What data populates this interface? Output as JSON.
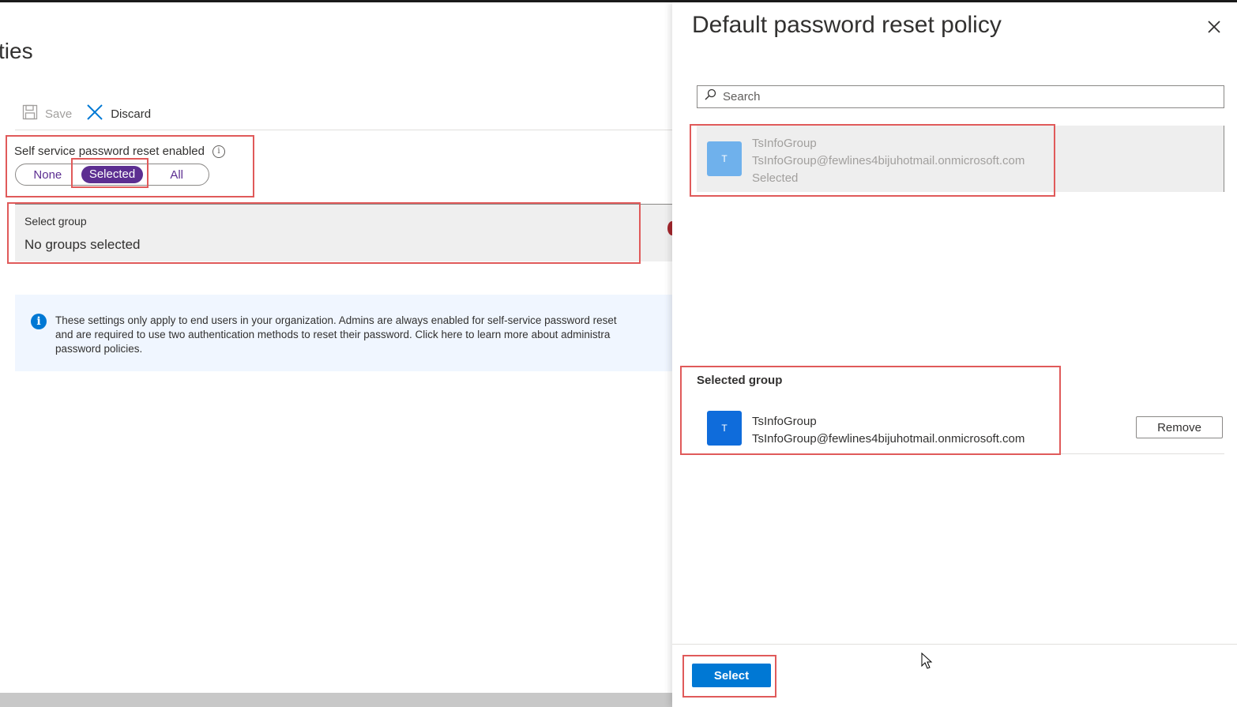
{
  "left": {
    "title": "ties",
    "toolbar": {
      "save_label": "Save",
      "discard_label": "Discard"
    },
    "sspr": {
      "label": "Self service password reset enabled",
      "info_icon": "info-icon",
      "options": [
        "None",
        "Selected",
        "All"
      ],
      "selected_option": "Selected"
    },
    "select_group": {
      "label": "Select group",
      "value": "No groups selected"
    },
    "info_banner": {
      "lines": [
        "These settings only apply to end users in your organization. Admins are always enabled for self-service password reset",
        "and are required to use two authentication methods to reset their password. Click here to learn more about administra",
        "password policies."
      ]
    }
  },
  "panel": {
    "title": "Default password reset policy",
    "search": {
      "placeholder": "Search",
      "value": ""
    },
    "result": {
      "avatar_letter": "T",
      "name": "TsInfoGroup",
      "email": "TsInfoGroup@fewlines4bijuhotmail.onmicrosoft.com",
      "status": "Selected"
    },
    "selected_heading": "Selected group",
    "selected_item": {
      "avatar_letter": "T",
      "name": "TsInfoGroup",
      "email": "TsInfoGroup@fewlines4bijuhotmail.onmicrosoft.com",
      "remove_label": "Remove"
    },
    "select_button": "Select"
  },
  "colors": {
    "accent_purple": "#5c2e91",
    "primary_blue": "#0078d4",
    "annotation_red": "#e05a5a"
  }
}
